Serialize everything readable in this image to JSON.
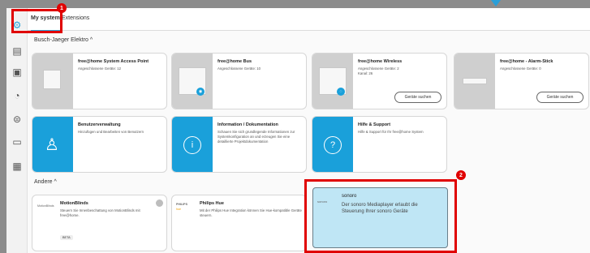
{
  "tabs": {
    "my_system": "My system",
    "extensions": "Extensions"
  },
  "sections": {
    "busch_jaeger": "Busch-Jaeger Elektro  ^",
    "andere": "Andere  ^"
  },
  "cards": {
    "access_point": {
      "title": "free@home System Access Point",
      "desc": "Angeschlossene Geräte: 12"
    },
    "bus": {
      "title": "free@home Bus",
      "desc": "Angeschlossene Geräte: 10"
    },
    "wireless": {
      "title": "free@home Wireless",
      "desc": "Angeschlossene Geräte: 2\nKanal: 26",
      "button": "Geräte suchen"
    },
    "alarm_stick": {
      "title": "free@home - Alarm-Stick",
      "desc": "Angeschlossene Geräte: 0",
      "button": "Geräte suchen"
    },
    "user_admin": {
      "title": "Benutzerverwaltung",
      "desc": "Hinzufügen und Bearbeiten von Benutzern"
    },
    "info_docs": {
      "title": "Information / Dokumentation",
      "desc": "Schauen Sie sich grundlegende Informationen zur Systemkonfiguration an und erzeugen Sie eine detaillierte Projektdokumentation"
    },
    "help": {
      "title": "Hilfe & Support",
      "desc": "Hilfe & Support für Ihr free@home System"
    },
    "motionblinds": {
      "title": "MotionBlinds",
      "desc": "Steuern Sie Innenbeschattung von MotionBlinds mit free@home.",
      "beta": "BETA"
    },
    "philips_hue": {
      "title": "Philips Hue",
      "desc": "Mit der Philips Hue Integration können Sie Hue-kompatible Geräte steuern.",
      "logo": "PHILIPS"
    },
    "sonoro": {
      "title": "sonoro",
      "logo": "sonoro",
      "desc": "Der sonoro Mediaplayer erlaubt die Steuerung Ihrer sonoro Geräte"
    }
  },
  "markers": {
    "one": "1",
    "two": "2"
  },
  "colors": {
    "accent": "#2aa3d9",
    "highlight": "#e00000",
    "sonoro_bg": "#bfe6f5"
  }
}
